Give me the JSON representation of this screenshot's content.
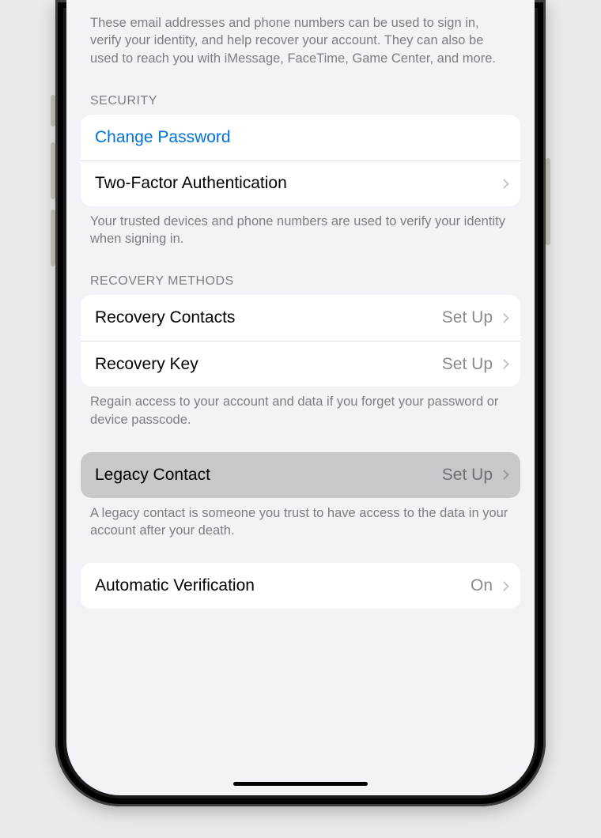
{
  "intro_footer": "These email addresses and phone numbers can be used to sign in, verify your identity, and help recover your account. They can also be used to reach you with iMessage, FaceTime, Game Center, and more.",
  "security": {
    "header": "SECURITY",
    "change_password": "Change Password",
    "two_factor": "Two-Factor Authentication",
    "footer": "Your trusted devices and phone numbers are used to verify your identity when signing in."
  },
  "recovery": {
    "header": "RECOVERY METHODS",
    "contacts_label": "Recovery Contacts",
    "contacts_value": "Set Up",
    "key_label": "Recovery Key",
    "key_value": "Set Up",
    "footer": "Regain access to your account and data if you forget your password or device passcode."
  },
  "legacy": {
    "label": "Legacy Contact",
    "value": "Set Up",
    "footer": "A legacy contact is someone you trust to have access to the data in your account after your death."
  },
  "auto_verify": {
    "label": "Automatic Verification",
    "value": "On"
  }
}
